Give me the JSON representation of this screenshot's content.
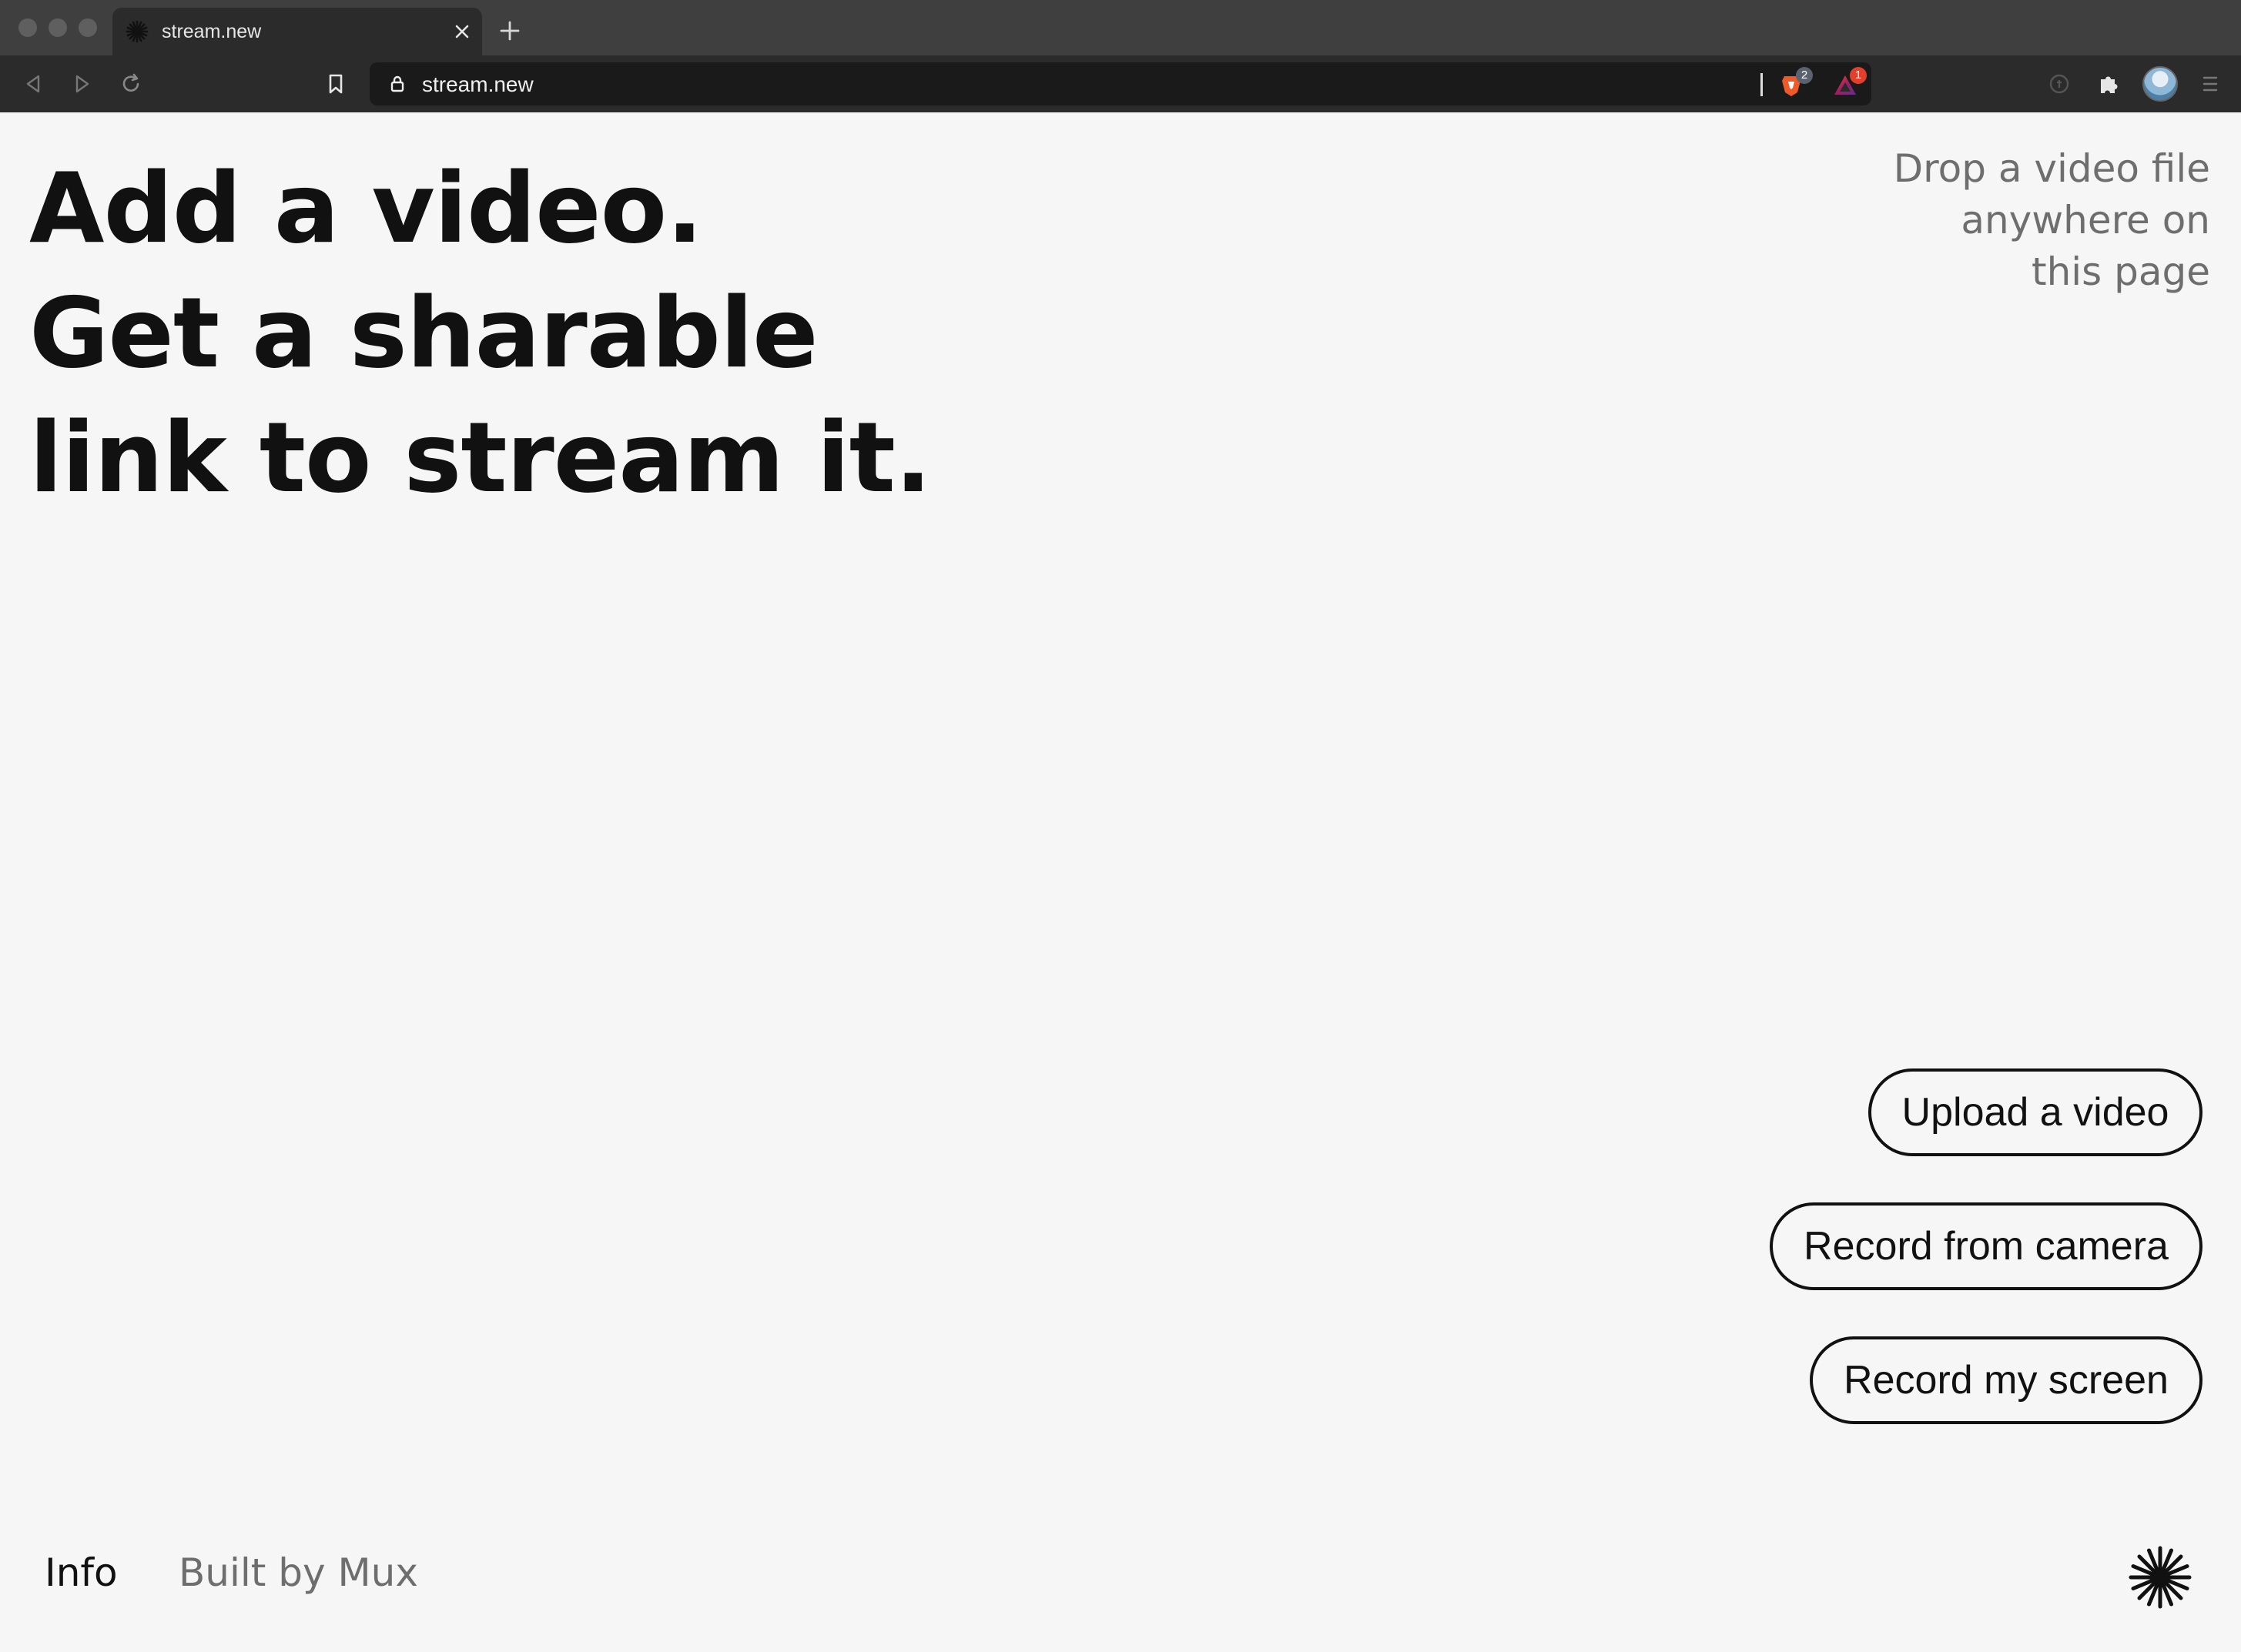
{
  "browser": {
    "tab_title": "stream.new",
    "url": "stream.new",
    "extensions": [
      {
        "name": "brave-shields-icon",
        "badge": "2",
        "badge_color": "#5a6270"
      },
      {
        "name": "brave-rewards-icon",
        "badge": "1",
        "badge_color": "#e0402c"
      }
    ]
  },
  "page": {
    "headline": [
      "Add a video.",
      "Get a sharable",
      "link to stream it."
    ],
    "drop_hint": [
      "Drop a video file",
      "anywhere on",
      "this page"
    ],
    "buttons": {
      "upload": "Upload a video",
      "camera": "Record from camera",
      "screen": "Record my screen"
    },
    "footer": {
      "info": "Info",
      "built_by": "Built by Mux"
    }
  },
  "colors": {
    "background": "#f6f6f6",
    "text": "#111111",
    "muted": "#6e6e6e"
  }
}
